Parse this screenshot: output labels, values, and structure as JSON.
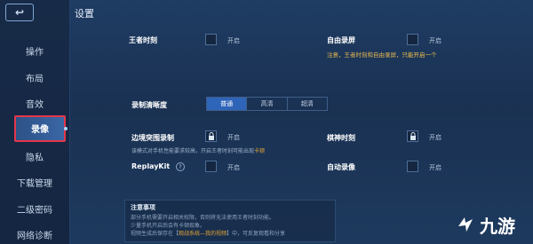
{
  "sidebar": {
    "back_label": "↩",
    "items": [
      {
        "label": "操作"
      },
      {
        "label": "布局"
      },
      {
        "label": "音效"
      },
      {
        "label": "录像"
      },
      {
        "label": "隐私"
      },
      {
        "label": "下载管理"
      },
      {
        "label": "二级密码"
      },
      {
        "label": "网络诊断"
      }
    ],
    "active_item": "录像"
  },
  "page": {
    "title": "设置"
  },
  "settings": {
    "king_moment": {
      "label": "王者时刻",
      "option": "开启",
      "checked": false
    },
    "free_record": {
      "label": "自由录屏",
      "option": "开启",
      "checked": false,
      "note_prefix": "注意，王者时刻和自由录屏，",
      "note_highlight": "只能开启一个"
    },
    "clarity": {
      "label": "录制清晰度",
      "options": [
        "普通",
        "高清",
        "超清"
      ],
      "selected": "普通"
    },
    "edge_breakout": {
      "label": "边境突围录制",
      "option": "开启",
      "locked": true,
      "hint_prefix": "该模式对手机性能要求较高，开启王者时刻可能出现",
      "hint_warn": "卡顿"
    },
    "chess_moment": {
      "label": "棋神时刻",
      "option": "开启",
      "locked": true
    },
    "replaykit": {
      "label": "ReplayKit",
      "option": "开启",
      "checked": false,
      "help": "?"
    },
    "auto_record": {
      "label": "自动录像",
      "option": "开启",
      "checked": false
    }
  },
  "notice": {
    "title": "注意事项",
    "lines": [
      "部分手机需要开启相关权限，否则将无法使用王者时刻功能。",
      "少量手机开启后会有卡顿现象。",
      {
        "prefix": "视频生成后保存在【",
        "highlight": "观战系统—我的视频",
        "suffix": "】中，可反复观看和分享"
      }
    ]
  },
  "watermark": {
    "text": "九游",
    "colors": {
      "logo": "#ffffff"
    }
  },
  "colors": {
    "accent_selected": "#2f65b8",
    "active_border": "#e5364a",
    "warning": "#e6a534"
  }
}
